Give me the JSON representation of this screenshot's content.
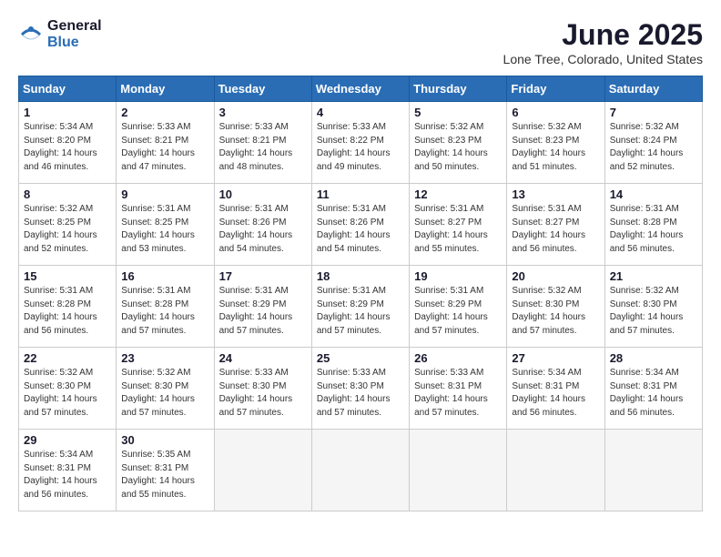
{
  "header": {
    "logo_general": "General",
    "logo_blue": "Blue",
    "month_title": "June 2025",
    "location": "Lone Tree, Colorado, United States"
  },
  "calendar": {
    "days_of_week": [
      "Sunday",
      "Monday",
      "Tuesday",
      "Wednesday",
      "Thursday",
      "Friday",
      "Saturday"
    ],
    "weeks": [
      [
        {
          "day": "1",
          "sunrise": "5:34 AM",
          "sunset": "8:20 PM",
          "daylight": "14 hours and 46 minutes."
        },
        {
          "day": "2",
          "sunrise": "5:33 AM",
          "sunset": "8:21 PM",
          "daylight": "14 hours and 47 minutes."
        },
        {
          "day": "3",
          "sunrise": "5:33 AM",
          "sunset": "8:21 PM",
          "daylight": "14 hours and 48 minutes."
        },
        {
          "day": "4",
          "sunrise": "5:33 AM",
          "sunset": "8:22 PM",
          "daylight": "14 hours and 49 minutes."
        },
        {
          "day": "5",
          "sunrise": "5:32 AM",
          "sunset": "8:23 PM",
          "daylight": "14 hours and 50 minutes."
        },
        {
          "day": "6",
          "sunrise": "5:32 AM",
          "sunset": "8:23 PM",
          "daylight": "14 hours and 51 minutes."
        },
        {
          "day": "7",
          "sunrise": "5:32 AM",
          "sunset": "8:24 PM",
          "daylight": "14 hours and 52 minutes."
        }
      ],
      [
        {
          "day": "8",
          "sunrise": "5:32 AM",
          "sunset": "8:25 PM",
          "daylight": "14 hours and 52 minutes."
        },
        {
          "day": "9",
          "sunrise": "5:31 AM",
          "sunset": "8:25 PM",
          "daylight": "14 hours and 53 minutes."
        },
        {
          "day": "10",
          "sunrise": "5:31 AM",
          "sunset": "8:26 PM",
          "daylight": "14 hours and 54 minutes."
        },
        {
          "day": "11",
          "sunrise": "5:31 AM",
          "sunset": "8:26 PM",
          "daylight": "14 hours and 54 minutes."
        },
        {
          "day": "12",
          "sunrise": "5:31 AM",
          "sunset": "8:27 PM",
          "daylight": "14 hours and 55 minutes."
        },
        {
          "day": "13",
          "sunrise": "5:31 AM",
          "sunset": "8:27 PM",
          "daylight": "14 hours and 56 minutes."
        },
        {
          "day": "14",
          "sunrise": "5:31 AM",
          "sunset": "8:28 PM",
          "daylight": "14 hours and 56 minutes."
        }
      ],
      [
        {
          "day": "15",
          "sunrise": "5:31 AM",
          "sunset": "8:28 PM",
          "daylight": "14 hours and 56 minutes."
        },
        {
          "day": "16",
          "sunrise": "5:31 AM",
          "sunset": "8:28 PM",
          "daylight": "14 hours and 57 minutes."
        },
        {
          "day": "17",
          "sunrise": "5:31 AM",
          "sunset": "8:29 PM",
          "daylight": "14 hours and 57 minutes."
        },
        {
          "day": "18",
          "sunrise": "5:31 AM",
          "sunset": "8:29 PM",
          "daylight": "14 hours and 57 minutes."
        },
        {
          "day": "19",
          "sunrise": "5:31 AM",
          "sunset": "8:29 PM",
          "daylight": "14 hours and 57 minutes."
        },
        {
          "day": "20",
          "sunrise": "5:32 AM",
          "sunset": "8:30 PM",
          "daylight": "14 hours and 57 minutes."
        },
        {
          "day": "21",
          "sunrise": "5:32 AM",
          "sunset": "8:30 PM",
          "daylight": "14 hours and 57 minutes."
        }
      ],
      [
        {
          "day": "22",
          "sunrise": "5:32 AM",
          "sunset": "8:30 PM",
          "daylight": "14 hours and 57 minutes."
        },
        {
          "day": "23",
          "sunrise": "5:32 AM",
          "sunset": "8:30 PM",
          "daylight": "14 hours and 57 minutes."
        },
        {
          "day": "24",
          "sunrise": "5:33 AM",
          "sunset": "8:30 PM",
          "daylight": "14 hours and 57 minutes."
        },
        {
          "day": "25",
          "sunrise": "5:33 AM",
          "sunset": "8:30 PM",
          "daylight": "14 hours and 57 minutes."
        },
        {
          "day": "26",
          "sunrise": "5:33 AM",
          "sunset": "8:31 PM",
          "daylight": "14 hours and 57 minutes."
        },
        {
          "day": "27",
          "sunrise": "5:34 AM",
          "sunset": "8:31 PM",
          "daylight": "14 hours and 56 minutes."
        },
        {
          "day": "28",
          "sunrise": "5:34 AM",
          "sunset": "8:31 PM",
          "daylight": "14 hours and 56 minutes."
        }
      ],
      [
        {
          "day": "29",
          "sunrise": "5:34 AM",
          "sunset": "8:31 PM",
          "daylight": "14 hours and 56 minutes."
        },
        {
          "day": "30",
          "sunrise": "5:35 AM",
          "sunset": "8:31 PM",
          "daylight": "14 hours and 55 minutes."
        },
        null,
        null,
        null,
        null,
        null
      ]
    ]
  }
}
